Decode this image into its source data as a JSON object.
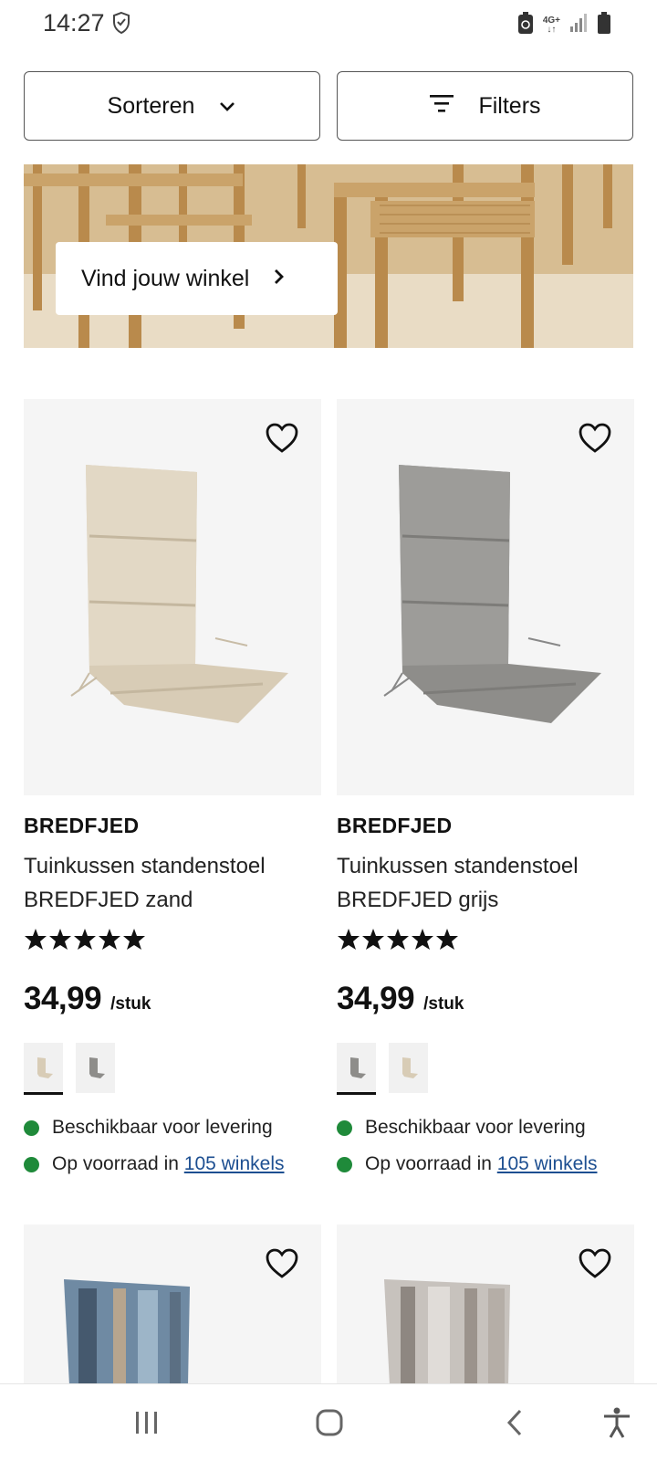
{
  "status": {
    "time": "14:27",
    "network": "4G+"
  },
  "toolbar": {
    "sort_label": "Sorteren",
    "filter_label": "Filters"
  },
  "banner": {
    "cta_label": "Vind jouw winkel"
  },
  "products": [
    {
      "brand": "BREDFJED",
      "title_line1": "Tuinkussen standenstoel",
      "title_line2": "BREDFJED zand",
      "rating_stars": 5,
      "price": "34,99",
      "unit": "/stuk",
      "availability_delivery": "Beschikbaar voor levering",
      "stock_prefix": "Op voorraad in",
      "stock_link": "105 winkels",
      "color": "#d8ccb6"
    },
    {
      "brand": "BREDFJED",
      "title_line1": "Tuinkussen standenstoel",
      "title_line2": "BREDFJED grijs",
      "rating_stars": 5,
      "price": "34,99",
      "unit": "/stuk",
      "availability_delivery": "Beschikbaar voor levering",
      "stock_prefix": "Op voorraad in",
      "stock_link": "105 winkels",
      "color": "#8e8d8a"
    }
  ],
  "colors": {
    "availability_dot": "#1f8a3a",
    "link": "#1d4f91"
  }
}
